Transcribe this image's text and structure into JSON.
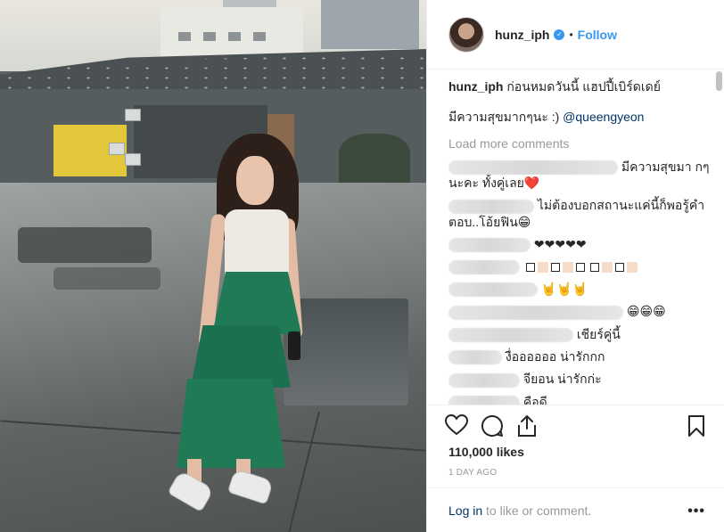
{
  "header": {
    "username": "hunz_iph",
    "verified_icon": "verified-badge-icon",
    "separator": "•",
    "follow_label": "Follow"
  },
  "caption": {
    "username": "hunz_iph",
    "text": "ก่อนหมดวันนี้ แฮปปี้เบิร์ดเดย์",
    "line2": "มีความสุขมากๆนะ :)",
    "mention": "@queengyeon"
  },
  "load_more": "Load more comments",
  "comments": [
    {
      "text": "มีความสุขมา กๆนะคะ ทั้งคู่เลย❤️"
    },
    {
      "text": "ไม่ต้องบอกสถานะแค่นี้ก็พอรู้คำตอบ..โอ้ยฟิน😁"
    },
    {
      "text": "❤❤❤❤❤"
    },
    {
      "text": ""
    },
    {
      "text": "🤘🤘🤘"
    },
    {
      "text": "😁😁😁"
    },
    {
      "text": "เชียร์คู่นี้"
    },
    {
      "text": "งื่ออออออ น่ารักกก"
    },
    {
      "text": "จียอน น่ารักก่ะ"
    },
    {
      "text": "คือดี"
    }
  ],
  "likes": "110,000 likes",
  "time": "1 DAY AGO",
  "login": {
    "link": "Log in",
    "rest": " to like or comment."
  },
  "more_label": "•••",
  "colors": {
    "accent": "#3897f0",
    "link": "#003569",
    "muted": "#999999",
    "text": "#262626",
    "skirt": "#1f7a55"
  }
}
